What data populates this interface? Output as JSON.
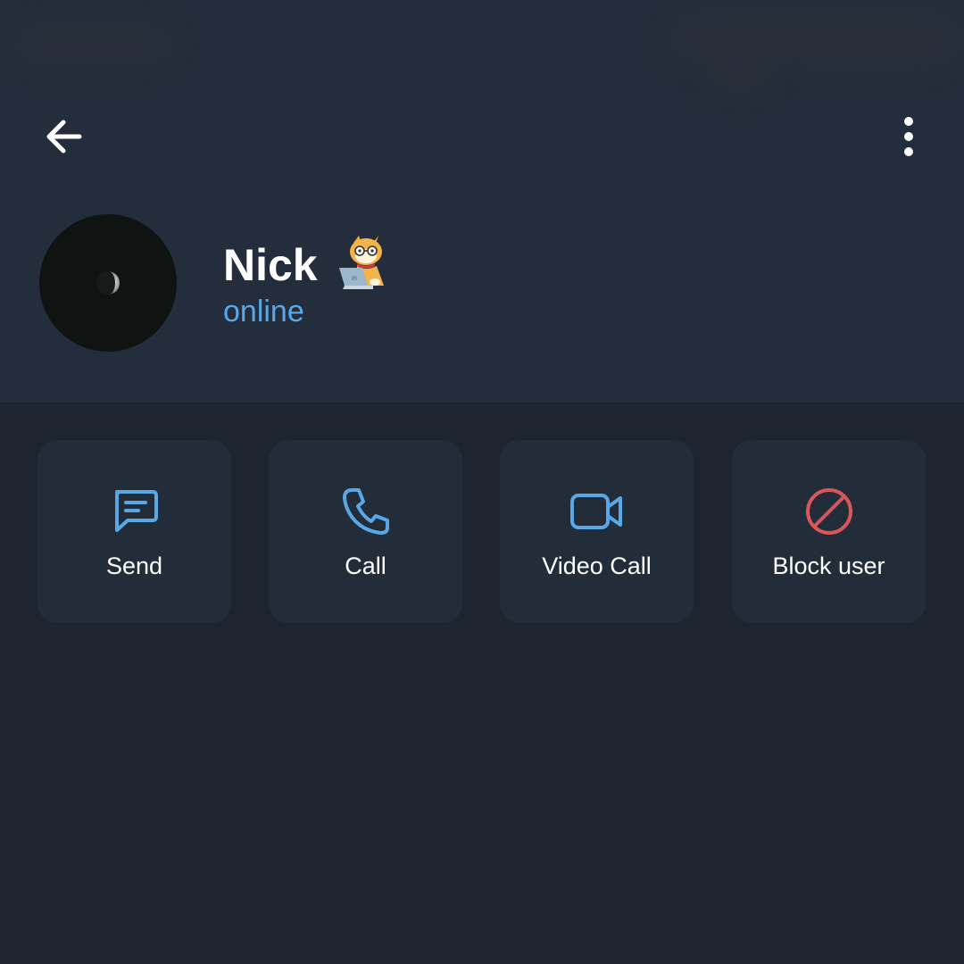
{
  "profile": {
    "name": "Nick",
    "status": "online",
    "status_color": "#5aa7e6",
    "sticker_icon": "cat-with-laptop-emoji",
    "avatar_icon": "moon-icon"
  },
  "toolbar": {
    "back_icon": "arrow-left-icon",
    "menu_icon": "more-vertical-icon"
  },
  "actions": [
    {
      "label": "Send",
      "icon": "message-icon",
      "color": "#5aa7e6"
    },
    {
      "label": "Call",
      "icon": "phone-icon",
      "color": "#5aa7e6"
    },
    {
      "label": "Video Call",
      "icon": "video-camera-icon",
      "color": "#5aa7e6"
    },
    {
      "label": "Block user",
      "icon": "block-icon",
      "color": "#d9575a"
    }
  ],
  "colors": {
    "background": "#1e2531",
    "header": "#232d3b",
    "card": "#232c39",
    "accent": "#5aa7e6",
    "danger": "#d9575a"
  }
}
